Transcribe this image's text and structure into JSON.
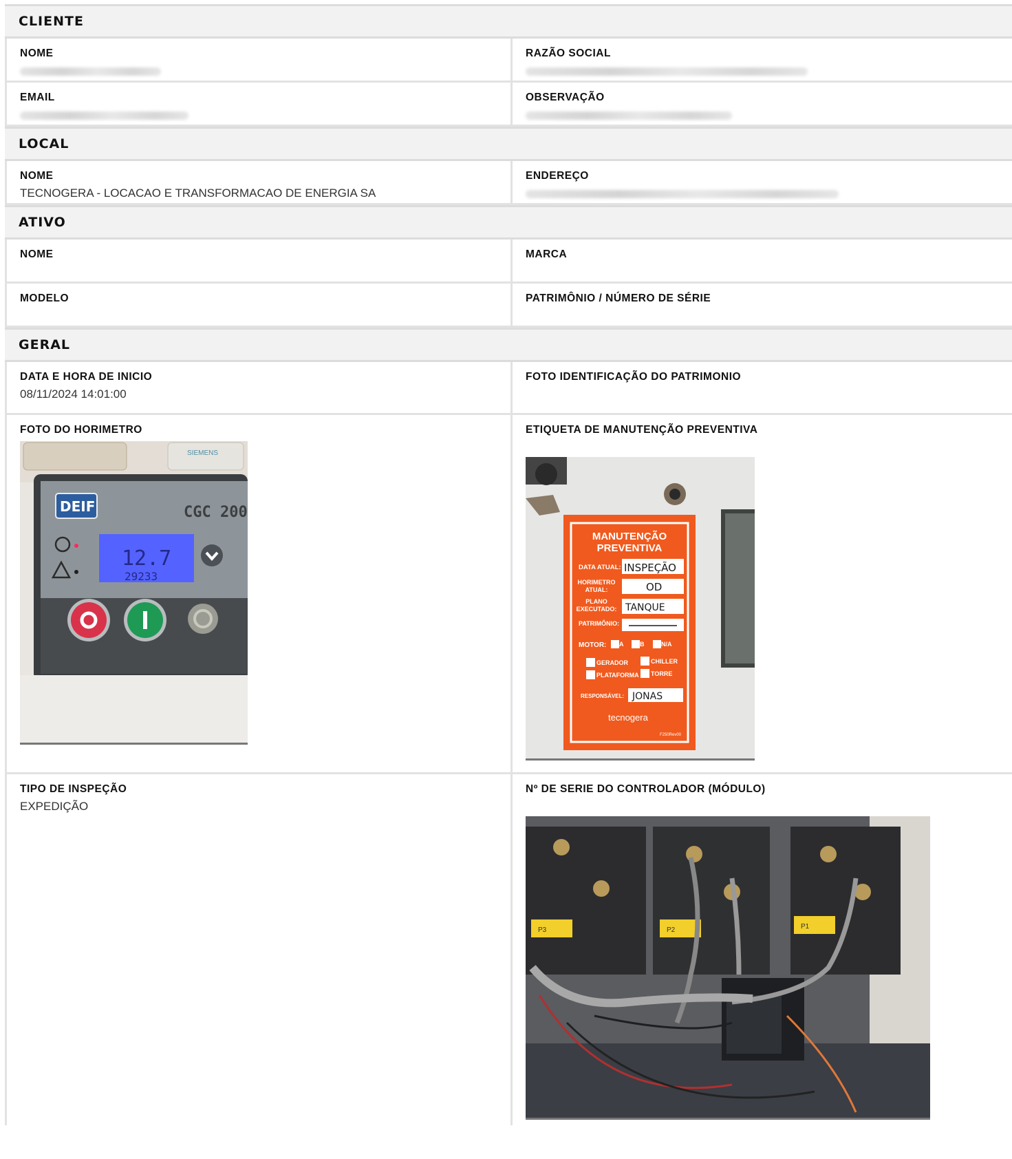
{
  "cliente": {
    "title": "CLIENTE",
    "nome_label": "NOME",
    "razao_label": "RAZÃO SOCIAL",
    "email_label": "EMAIL",
    "obs_label": "OBSERVAÇÃO"
  },
  "local": {
    "title": "LOCAL",
    "nome_label": "NOME",
    "nome_value": "TECNOGERA - LOCACAO E TRANSFORMACAO DE ENERGIA SA",
    "endereco_label": "ENDEREÇO"
  },
  "ativo": {
    "title": "ATIVO",
    "nome_label": "NOME",
    "marca_label": "MARCA",
    "modelo_label": "MODELO",
    "patrimonio_label": "PATRIMÔNIO / NÚMERO DE SÉRIE"
  },
  "geral": {
    "title": "GERAL",
    "data_label": "DATA E HORA DE INICIO",
    "data_value": "08/11/2024 14:01:00",
    "foto_id_label": "FOTO IDENTIFICAÇÃO DO PATRIMONIO",
    "horimetro_label": "FOTO DO HORIMETRO",
    "etiqueta_label": "ETIQUETA DE MANUTENÇÃO PREVENTIVA",
    "tipo_label": "TIPO DE INSPEÇÃO",
    "tipo_value": "EXPEDIÇÃO",
    "serie_label": "Nº DE SERIE DO CONTROLADOR (MÓDULO)"
  },
  "photos": {
    "horimetro": {
      "brand": "DEIF",
      "model": "CGC 200",
      "display_main": "12.7",
      "display_sub": "29233",
      "panel_top": "SIEMENS"
    },
    "etiqueta": {
      "title_line1": "MANUTENÇÃO",
      "title_line2": "PREVENTIVA",
      "data_atual": "DATA ATUAL:",
      "data_atual_hand": "INSPEÇÃO",
      "horimetro1": "HORIMETRO",
      "horimetro2": "ATUAL:",
      "horimetro_hand": "OD",
      "plano1": "PLANO",
      "plano2": "EXECUTADO:",
      "plano_hand": "TANQUE",
      "patrimonio": "PATRIMÔNIO:",
      "motor": "MOTOR:",
      "opt_a": "A",
      "opt_b": "B",
      "opt_na": "N/A",
      "gerador": "GERADOR",
      "chiller": "CHILLER",
      "plataforma": "PLATAFORMA",
      "torre": "TORRE",
      "responsavel": "RESPONSÁVEL:",
      "responsavel_hand": "JONAS",
      "logo": "tecnogera",
      "code": "F250Rev00"
    },
    "modulo": {
      "tag_p3": "P3",
      "tag_p2": "P2",
      "tag_p1": "P1"
    }
  },
  "colors": {
    "section_bg": "#f2f2f2",
    "border": "#e2e2e2",
    "tag_orange": "#f05a1e"
  }
}
